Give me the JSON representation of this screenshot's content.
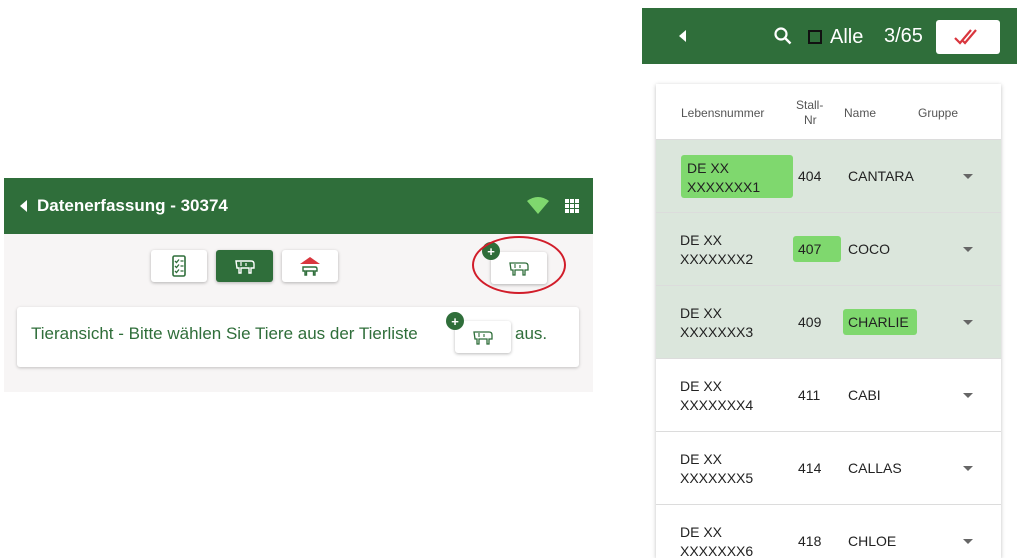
{
  "left": {
    "header": {
      "title": "Datenerfassung - 30374",
      "icons": [
        "back-arrow-icon",
        "wifi-icon",
        "apps-grid-icon"
      ]
    },
    "toolbar": {
      "buttons": [
        {
          "icon": "checklist-icon",
          "active": false
        },
        {
          "icon": "cow-icon",
          "active": true
        },
        {
          "icon": "barn-icon",
          "active": false
        }
      ],
      "add_animal_button": {
        "icon": "cow-icon",
        "badge": "+"
      }
    },
    "info": {
      "text_before": "Tieransicht - Bitte wählen Sie Tiere aus der Tierliste",
      "text_after": "aus.",
      "badge": "+"
    }
  },
  "right": {
    "header": {
      "select_all_label": "Alle",
      "count": "3/65",
      "icons": [
        "back-arrow-icon",
        "search-icon",
        "checkbox-icon",
        "double-check-icon"
      ]
    },
    "table": {
      "columns": {
        "lebensnummer": "Lebensnummer",
        "stall_nr_1": "Stall-",
        "stall_nr_2": "Nr",
        "name": "Name",
        "gruppe": "Gruppe"
      },
      "rows": [
        {
          "leb1": "DE XX",
          "leb2": "XXXXXXX1",
          "stall": "404",
          "name": "CANTARA",
          "selected": true,
          "highlight": "lebensnummer"
        },
        {
          "leb1": "DE XX",
          "leb2": "XXXXXXX2",
          "stall": "407",
          "name": "COCO",
          "selected": true,
          "highlight": "stall"
        },
        {
          "leb1": "DE XX",
          "leb2": "XXXXXXX3",
          "stall": "409",
          "name": "CHARLIE",
          "selected": true,
          "highlight": "name"
        },
        {
          "leb1": "DE XX",
          "leb2": "XXXXXXX4",
          "stall": "411",
          "name": "CABI",
          "selected": false,
          "highlight": ""
        },
        {
          "leb1": "DE XX",
          "leb2": "XXXXXXX5",
          "stall": "414",
          "name": "CALLAS",
          "selected": false,
          "highlight": ""
        },
        {
          "leb1": "DE XX",
          "leb2": "XXXXXXX6",
          "stall": "418",
          "name": "CHLOE",
          "selected": false,
          "highlight": ""
        }
      ]
    }
  },
  "colors": {
    "brand_green": "#2f6e3a",
    "highlight_green": "#7fd86e",
    "selected_row": "#dbe6dc",
    "annotation_red": "#d11d2a",
    "check_red": "#d9363e"
  }
}
